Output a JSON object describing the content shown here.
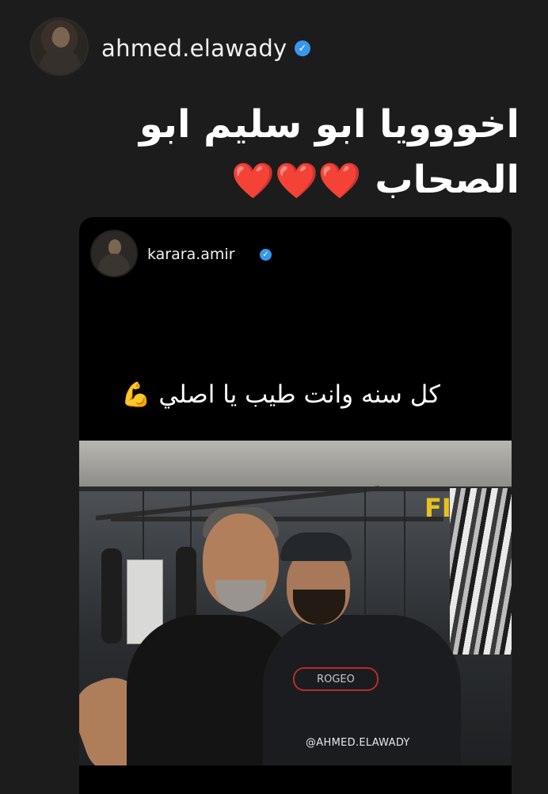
{
  "header": {
    "username": "ahmed.elawady",
    "verified": true
  },
  "caption": {
    "text": "اخووويا ابو سليم ابو الصحاب",
    "hearts": "❤️❤️❤️"
  },
  "shared_post": {
    "username": "karara.amir",
    "verified": true,
    "story_text": "كل سنه وانت طيب يا اصلي",
    "story_emoji": "💪",
    "photo": {
      "gym_sign": "FI",
      "shirt_text": "ROGEO",
      "watermark": "@AHMED.ELAWADY"
    }
  },
  "colors": {
    "background": "#1c1c1c",
    "verified_badge": "#3797f0",
    "heart": "#e11b22"
  }
}
